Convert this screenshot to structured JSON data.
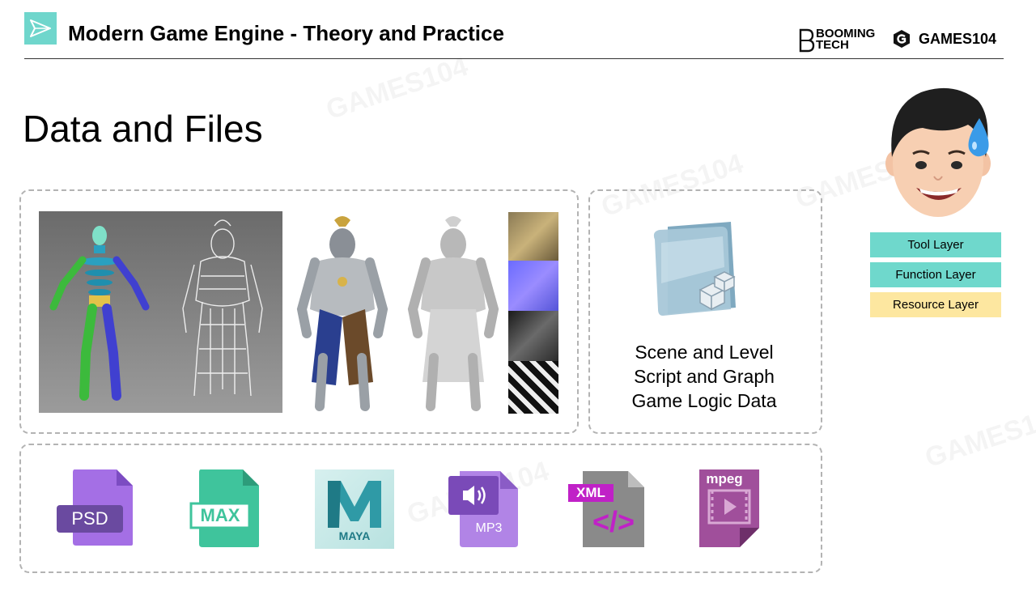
{
  "header": {
    "course_title": "Modern Game Engine - Theory and Practice",
    "brand_booming_line1": "BOOMING",
    "brand_booming_line2": "TECH",
    "brand_games": "GAMES104"
  },
  "slide": {
    "title": "Data and Files"
  },
  "scene_panel": {
    "lines": [
      "Scene and Level",
      "Script and Graph",
      "Game Logic Data"
    ]
  },
  "layers": {
    "tool": "Tool Layer",
    "function": "Function Layer",
    "resource": "Resource Layer"
  },
  "file_icons": {
    "psd": "PSD",
    "max": "MAX",
    "maya": "MAYA",
    "mp3": "MP3",
    "xml": "XML",
    "xml_glyph": "</>",
    "mpeg": "mpeg"
  },
  "watermark": "GAMES104",
  "colors": {
    "teal": "#6fd8cc",
    "yellow": "#fde7a0",
    "psd_purple": "#9b6fe0",
    "max_green": "#3fbf9a",
    "maya_teal": "#2f9aa6",
    "mp3_purple": "#a77be0",
    "xml_magenta": "#c021c7",
    "mpeg_purple": "#a04f9b"
  }
}
